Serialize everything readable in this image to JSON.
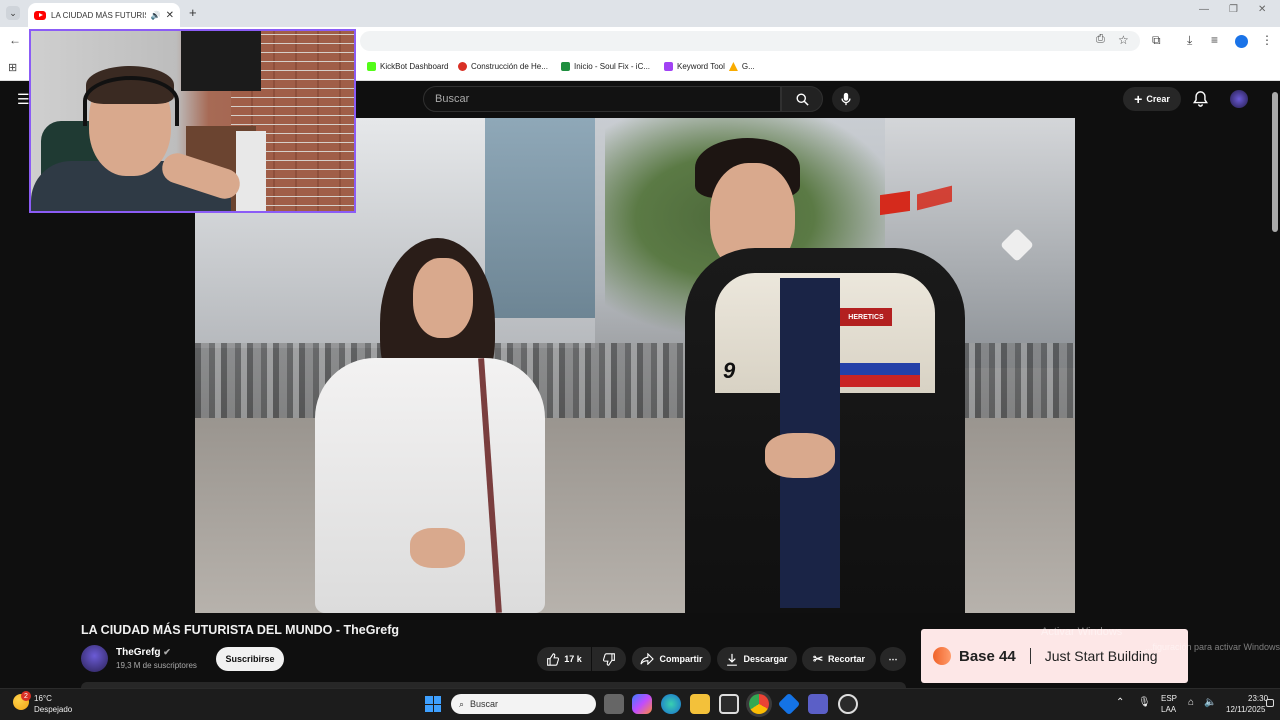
{
  "browser": {
    "tab_title": "LA CIUDAD MÁS FUTURISTA",
    "new_tab": "+",
    "bookmarks": [
      {
        "label": "KickBot Dashboard",
        "color": "#53fc18"
      },
      {
        "label": "Construcción de He...",
        "color": "#d93025"
      },
      {
        "label": "Inicio - Soul Fix - iC...",
        "color": "#1e8e3e"
      },
      {
        "label": "Keyword Tool",
        "color": "#a142f4"
      },
      {
        "label": "G...",
        "color": "#f9ab00"
      }
    ]
  },
  "youtube": {
    "search_placeholder": "Buscar",
    "create_label": "Crear",
    "video_title": "LA CIUDAD MÁS FUTURISTA DEL MUNDO - TheGrefg",
    "channel_name": "TheGrefg",
    "subscribers": "19,3 M de suscriptores",
    "subscribe_label": "Suscribirse",
    "likes": "17 k",
    "share_label": "Compartir",
    "download_label": "Descargar",
    "clip_label": "Recortar",
    "more_label": "⋯",
    "jacket_text": "HERETICS",
    "jacket_number": "9"
  },
  "ad": {
    "brand": "Base 44",
    "tagline": "Just Start Building"
  },
  "watermark": {
    "line1": "Activar Windows",
    "line2": "...figuración para activar Windows."
  },
  "taskbar": {
    "weather_temp": "16°C",
    "weather_desc": "Despejado",
    "weather_badge": "2",
    "search_placeholder": "Buscar",
    "lang_top": "ESP",
    "lang_bottom": "LAA",
    "time": "23:30",
    "date": "12/11/2025"
  },
  "colors": {
    "webcam_border": "#8b5cf6",
    "youtube_red": "#ff0000",
    "ad_background": "#fde7e7"
  }
}
